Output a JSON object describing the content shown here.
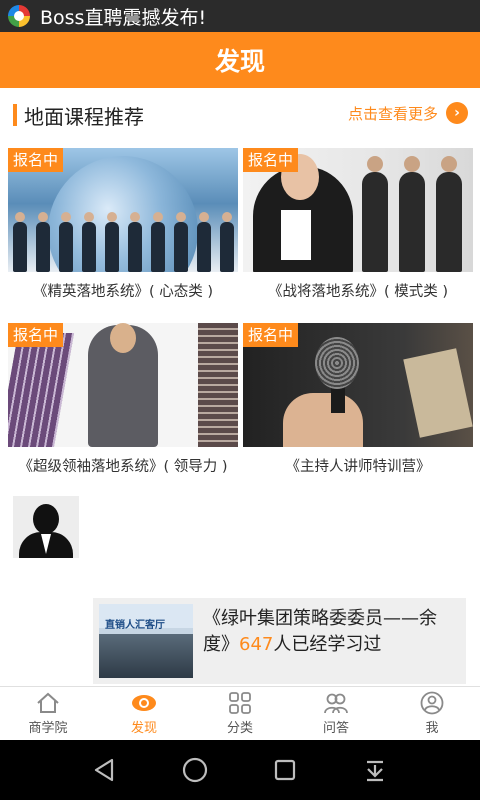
{
  "status_bar": {
    "notification_icon": "colorful-app-icon",
    "text": "Boss直聘震撼发布!"
  },
  "app_bar": {
    "title": "发现"
  },
  "section": {
    "title": "地面课程推荐",
    "more_label": "点击查看更多",
    "more_icon": "chevron-right-circle-icon"
  },
  "courses": [
    {
      "tag": "报名中",
      "title": "《精英落地系统》( 心态类 )"
    },
    {
      "tag": "报名中",
      "title": "《战将落地系统》( 模式类 )"
    },
    {
      "tag": "报名中",
      "title": "《超级领袖落地系统》( 领导力 )"
    },
    {
      "tag": "报名中",
      "title": "《主持人讲师特训营》"
    }
  ],
  "toast": {
    "thumb_text": "直销人汇客厅",
    "text_before": "《绿叶集团策略委委员——余度》",
    "count": "647",
    "text_after": "人已经学习过"
  },
  "tabs": [
    {
      "label": "商学院",
      "icon": "home-icon",
      "active": false
    },
    {
      "label": "发现",
      "icon": "eye-icon",
      "active": true
    },
    {
      "label": "分类",
      "icon": "grid-icon",
      "active": false
    },
    {
      "label": "问答",
      "icon": "users-icon",
      "active": false
    },
    {
      "label": "我",
      "icon": "profile-icon",
      "active": false
    }
  ],
  "nav": [
    {
      "icon": "back-icon"
    },
    {
      "icon": "home-circle-icon"
    },
    {
      "icon": "recents-icon"
    },
    {
      "icon": "notifications-pull-icon"
    }
  ],
  "colors": {
    "accent": "#fe8a1c",
    "status_bar": "#2b2b2b",
    "nav_bar": "#000000"
  }
}
